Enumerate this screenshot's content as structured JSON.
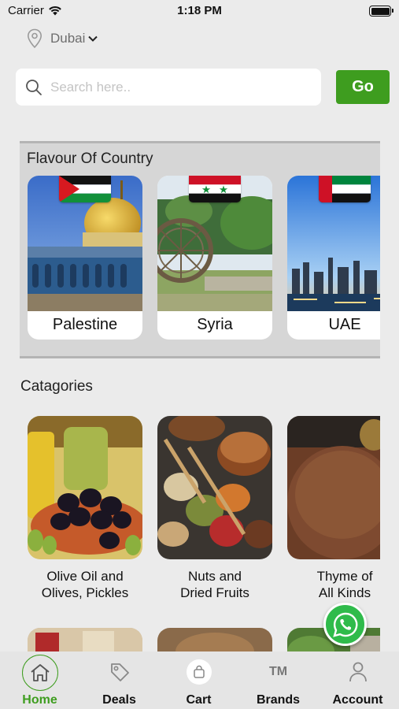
{
  "status_bar": {
    "carrier": "Carrier",
    "time": "1:18 PM"
  },
  "location": {
    "city": "Dubai",
    "icon": "location-pin-icon"
  },
  "search": {
    "placeholder": "Search here..",
    "value": "",
    "go_label": "Go"
  },
  "flavour": {
    "title": "Flavour Of Country",
    "countries": [
      {
        "name": "Palestine",
        "flag": "palestine-flag"
      },
      {
        "name": "Syria",
        "flag": "syria-flag"
      },
      {
        "name": "UAE",
        "flag": "uae-flag"
      }
    ]
  },
  "categories": {
    "title": "Catagories",
    "items": [
      {
        "label_line1": "Olive Oil and",
        "label_line2": "Olives, Pickles"
      },
      {
        "label_line1": "Nuts and",
        "label_line2": "Dried Fruits"
      },
      {
        "label_line1": "Thyme of",
        "label_line2": "All Kinds"
      }
    ]
  },
  "tabs": [
    {
      "label": "Home",
      "icon": "home-icon",
      "active": true
    },
    {
      "label": "Deals",
      "icon": "tag-icon",
      "active": false
    },
    {
      "label": "Cart",
      "icon": "shopping-bag-icon",
      "active": false
    },
    {
      "label": "Brands",
      "icon": "trademark-icon",
      "active": false
    },
    {
      "label": "Account",
      "icon": "person-icon",
      "active": false
    }
  ],
  "brands_glyph": "TM",
  "colors": {
    "accent": "#3e9d1f",
    "background": "#ebebeb",
    "whatsapp": "#2fbb4b"
  }
}
